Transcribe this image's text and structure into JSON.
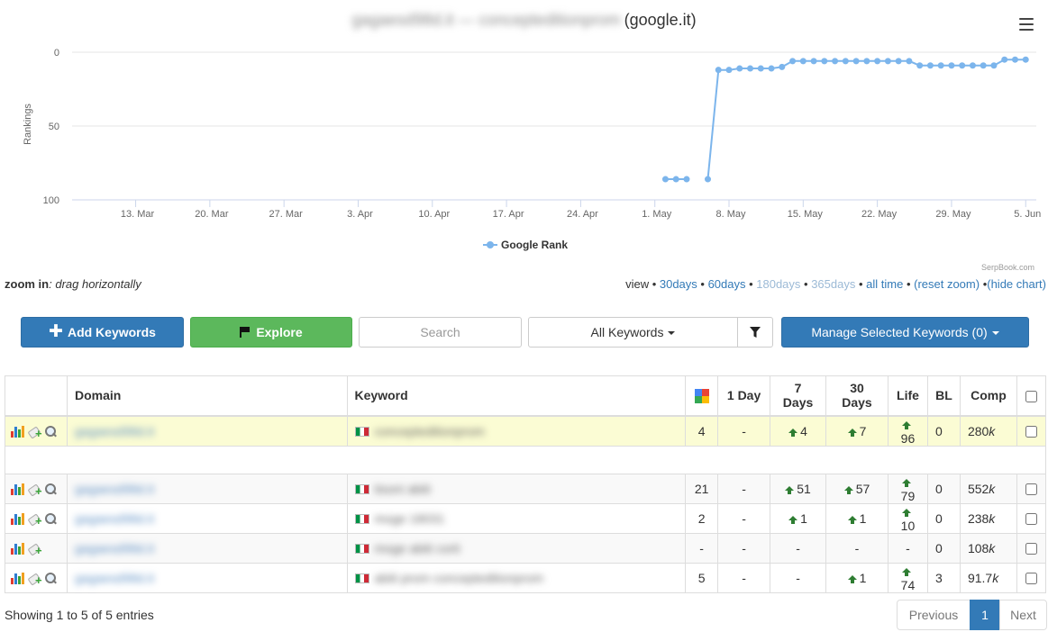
{
  "chart": {
    "title_site": "gagaesd98d.it — concepteditionprom",
    "title_engine": "(google.it)",
    "ylabel": "Rankings",
    "legend": "Google Rank",
    "credits": "SerpBook.com",
    "series_color": "#7cb5ec"
  },
  "chart_data": {
    "type": "line",
    "title": "(google.it)",
    "ylabel": "Rankings",
    "y_reversed": true,
    "ylim": [
      0,
      100
    ],
    "y_ticks": [
      0,
      50,
      100
    ],
    "x_ticks": [
      "13. Mar",
      "20. Mar",
      "27. Mar",
      "3. Apr",
      "10. Apr",
      "17. Apr",
      "24. Apr",
      "1. May",
      "8. May",
      "15. May",
      "22. May",
      "29. May",
      "5. Jun"
    ],
    "x_range": [
      "2017-03-07",
      "2017-06-06"
    ],
    "grid": true,
    "legend_position": "bottom",
    "series": [
      {
        "name": "Google Rank",
        "points": [
          {
            "x": "2017-05-02",
            "y": 86
          },
          {
            "x": "2017-05-03",
            "y": 86
          },
          {
            "x": "2017-05-04",
            "y": 86
          },
          {
            "x": "2017-05-06",
            "y": 86
          },
          {
            "x": "2017-05-07",
            "y": 12
          },
          {
            "x": "2017-05-08",
            "y": 12
          },
          {
            "x": "2017-05-09",
            "y": 11
          },
          {
            "x": "2017-05-10",
            "y": 11
          },
          {
            "x": "2017-05-11",
            "y": 11
          },
          {
            "x": "2017-05-12",
            "y": 11
          },
          {
            "x": "2017-05-13",
            "y": 10
          },
          {
            "x": "2017-05-14",
            "y": 6
          },
          {
            "x": "2017-05-15",
            "y": 6
          },
          {
            "x": "2017-05-16",
            "y": 6
          },
          {
            "x": "2017-05-17",
            "y": 6
          },
          {
            "x": "2017-05-18",
            "y": 6
          },
          {
            "x": "2017-05-19",
            "y": 6
          },
          {
            "x": "2017-05-20",
            "y": 6
          },
          {
            "x": "2017-05-21",
            "y": 6
          },
          {
            "x": "2017-05-22",
            "y": 6
          },
          {
            "x": "2017-05-23",
            "y": 6
          },
          {
            "x": "2017-05-24",
            "y": 6
          },
          {
            "x": "2017-05-25",
            "y": 6
          },
          {
            "x": "2017-05-26",
            "y": 9
          },
          {
            "x": "2017-05-27",
            "y": 9
          },
          {
            "x": "2017-05-28",
            "y": 9
          },
          {
            "x": "2017-05-29",
            "y": 9
          },
          {
            "x": "2017-05-30",
            "y": 9
          },
          {
            "x": "2017-05-31",
            "y": 9
          },
          {
            "x": "2017-06-01",
            "y": 9
          },
          {
            "x": "2017-06-02",
            "y": 9
          },
          {
            "x": "2017-06-03",
            "y": 5
          },
          {
            "x": "2017-06-04",
            "y": 5
          },
          {
            "x": "2017-06-05",
            "y": 5
          }
        ]
      }
    ]
  },
  "zoom": {
    "label": "zoom in",
    "hint": ": drag horizontally"
  },
  "view": {
    "prefix": "view • ",
    "links": [
      {
        "label": "30days",
        "disabled": false
      },
      {
        "label": "60days",
        "disabled": false
      },
      {
        "label": "180days",
        "disabled": true
      },
      {
        "label": "365days",
        "disabled": true
      },
      {
        "label": "all time",
        "disabled": false
      },
      {
        "label": "(reset zoom)",
        "disabled": false
      },
      {
        "label": "(hide chart)",
        "disabled": false
      }
    ]
  },
  "toolbar": {
    "add_label": "Add Keywords",
    "explore_label": "Explore",
    "search_placeholder": "Search",
    "select_label": "All Keywords",
    "manage_label": "Manage Selected Keywords (0)"
  },
  "table": {
    "headers": {
      "domain": "Domain",
      "keyword": "Keyword",
      "day1": "1 Day",
      "days7": "7 Days",
      "days30": "30 Days",
      "life": "Life",
      "bl": "BL",
      "comp": "Comp"
    },
    "rows": [
      {
        "domain": "gagaesd98d.it",
        "keyword": "concepteditionprom",
        "rank": "4",
        "day1": "-",
        "days7": "4",
        "days7_up": true,
        "days30": "7",
        "days30_up": true,
        "life": "96",
        "life_up": true,
        "bl": "0",
        "comp_num": "280",
        "comp_unit": "k",
        "search": true
      },
      {
        "domain": "gagaesd98d.it",
        "keyword": "tisoni abiti",
        "rank": "21",
        "day1": "-",
        "days7": "51",
        "days7_up": true,
        "days30": "57",
        "days30_up": true,
        "life": "79",
        "life_up": true,
        "bl": "0",
        "comp_num": "552",
        "comp_unit": "k",
        "search": true
      },
      {
        "domain": "gagaesd98d.it",
        "keyword": "moge 18031",
        "rank": "2",
        "day1": "-",
        "days7": "1",
        "days7_up": true,
        "days30": "1",
        "days30_up": true,
        "life": "10",
        "life_up": true,
        "bl": "0",
        "comp_num": "238",
        "comp_unit": "k",
        "search": true
      },
      {
        "domain": "gagaesd98d.it",
        "keyword": "moge abiti corti",
        "rank": "-",
        "day1": "-",
        "days7": "-",
        "days7_up": false,
        "days30": "-",
        "days30_up": false,
        "life": "-",
        "life_up": false,
        "bl": "0",
        "comp_num": "108",
        "comp_unit": "k",
        "search": false
      },
      {
        "domain": "gagaesd98d.it",
        "keyword": "abiti prom concepteditionprom",
        "rank": "5",
        "day1": "-",
        "days7": "-",
        "days7_up": false,
        "days30": "1",
        "days30_up": true,
        "life": "74",
        "life_up": true,
        "bl": "3",
        "comp_num": "91.7",
        "comp_unit": "k",
        "search": true
      }
    ]
  },
  "footer": {
    "entries": "Showing 1 to 5 of 5 entries",
    "prev": "Previous",
    "page": "1",
    "next": "Next"
  },
  "icons": {
    "add": "plus-icon",
    "explore": "flag-icon",
    "filter": "funnel-icon",
    "menu": "hamburger-menu-icon",
    "rank_col": "google-icon",
    "row_actions": [
      "bar-chart-icon",
      "tag-add-icon",
      "magnifier-icon"
    ],
    "trend": "up-arrow-icon",
    "flag": "italy-flag-icon"
  }
}
